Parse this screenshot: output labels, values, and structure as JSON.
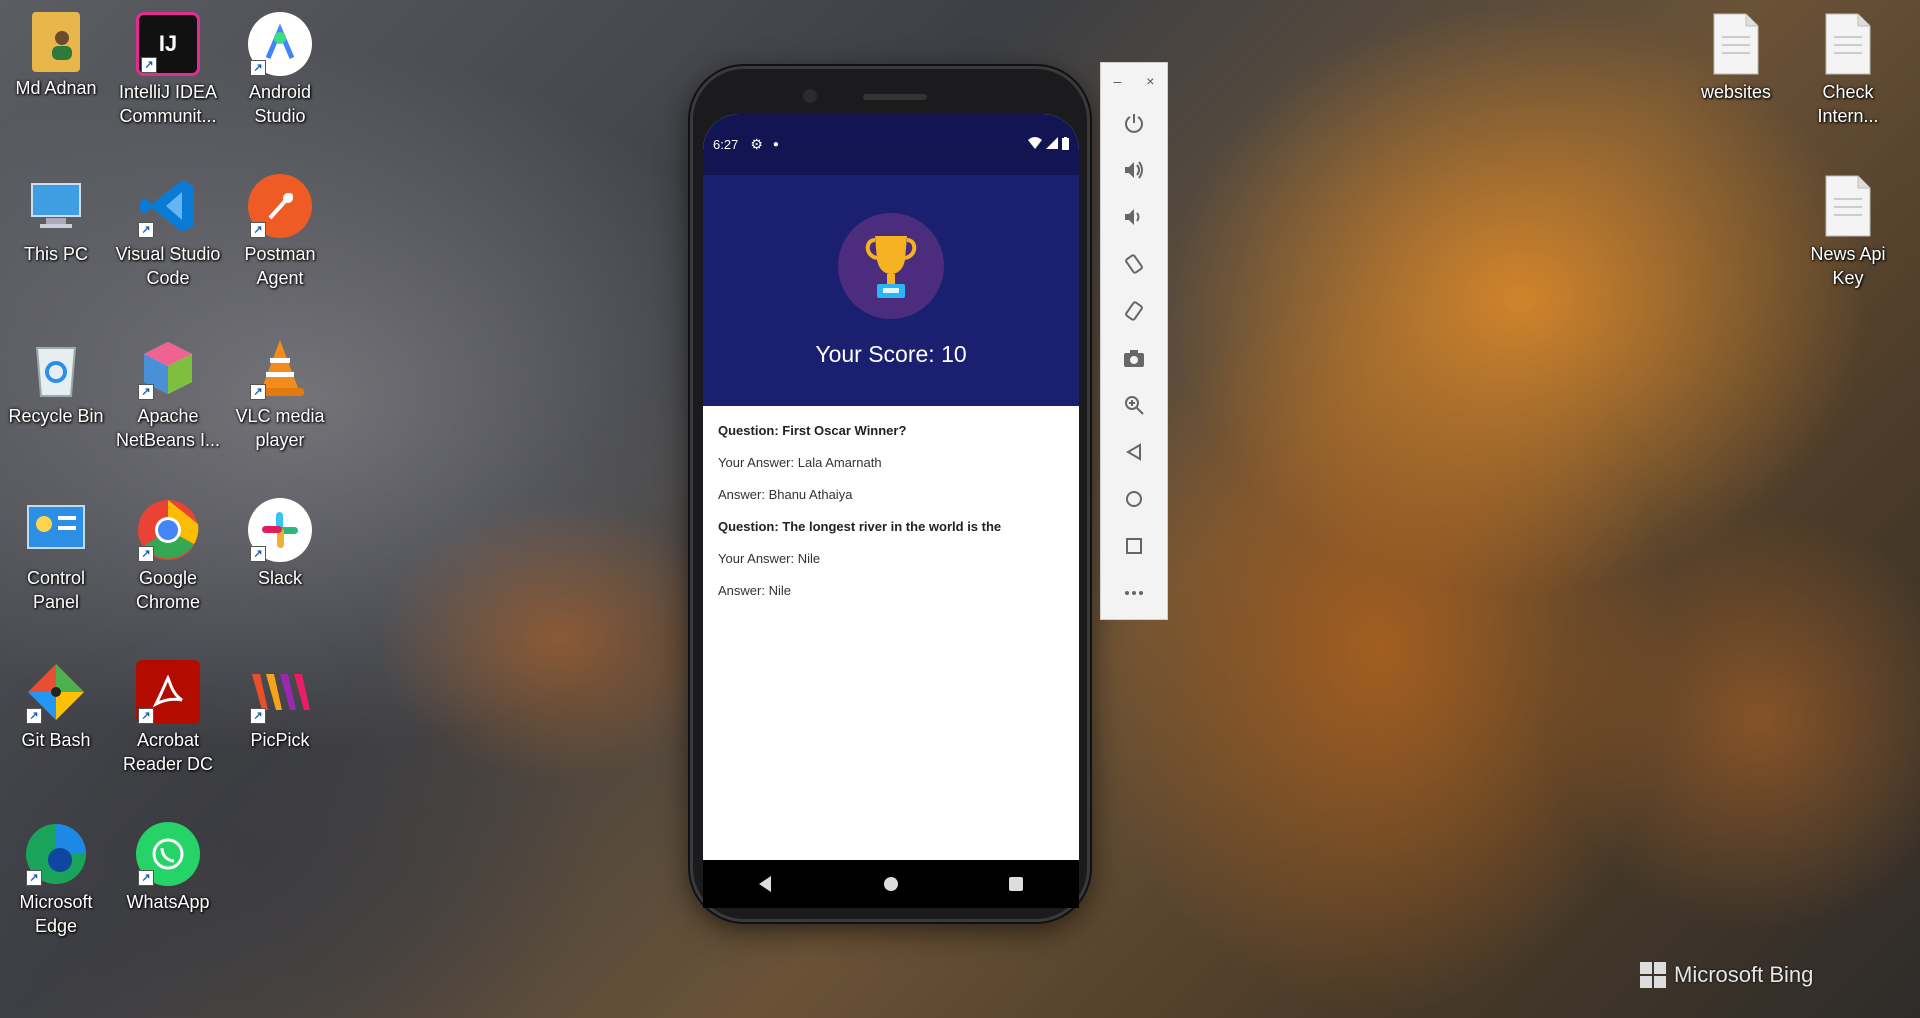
{
  "desktop_icons": [
    {
      "label": "Md Adnan",
      "icon": "user-folder-icon",
      "color": "#e8b64a"
    },
    {
      "label": "IntelliJ IDEA\nCommunit...",
      "icon": "intellij-icon",
      "color": "#111111"
    },
    {
      "label": "Android\nStudio",
      "icon": "android-studio-icon",
      "color": "#3ddc84"
    },
    {
      "label": "This PC",
      "icon": "this-pc-icon",
      "color": "#4aa3df"
    },
    {
      "label": "Visual Studio\nCode",
      "icon": "vscode-icon",
      "color": "#0078d4"
    },
    {
      "label": "Postman\nAgent",
      "icon": "postman-icon",
      "color": "#ef5b25"
    },
    {
      "label": "Recycle Bin",
      "icon": "recycle-bin-icon",
      "color": "#cfd8dc"
    },
    {
      "label": "Apache\nNetBeans I...",
      "icon": "netbeans-icon",
      "color": "#7fbf3f"
    },
    {
      "label": "VLC media\nplayer",
      "icon": "vlc-icon",
      "color": "#f28c1c"
    },
    {
      "label": "Control Panel",
      "icon": "control-panel-icon",
      "color": "#2d8ee6"
    },
    {
      "label": "Google\nChrome",
      "icon": "chrome-icon",
      "color": "#ea4335"
    },
    {
      "label": "Slack",
      "icon": "slack-icon",
      "color": "#ffffff"
    },
    {
      "label": "Git Bash",
      "icon": "git-bash-icon",
      "color": "#e84e31"
    },
    {
      "label": "Acrobat\nReader DC",
      "icon": "acrobat-icon",
      "color": "#b30b00"
    },
    {
      "label": "PicPick",
      "icon": "picpick-icon",
      "color": "#e9502a"
    },
    {
      "label": "Microsoft\nEdge",
      "icon": "edge-icon",
      "color": "#1aa35a"
    },
    {
      "label": "WhatsApp",
      "icon": "whatsapp-icon",
      "color": "#25d366"
    },
    {
      "label": "websites",
      "icon": "text-file-icon",
      "color": "#f4f4f4"
    },
    {
      "label": "Check\nIntern...",
      "icon": "text-file-icon",
      "color": "#f4f4f4"
    },
    {
      "label": "News Api Key",
      "icon": "text-file-icon",
      "color": "#f4f4f4"
    }
  ],
  "phone": {
    "status_time": "6:27",
    "score_text": "Your Score: 10",
    "results": [
      {
        "question": "Question: First Oscar Winner?",
        "your_answer": "Your Answer: Lala Amarnath",
        "answer": "Answer: Bhanu Athaiya"
      },
      {
        "question": "Question: The longest river in the world is the",
        "your_answer": "Your Answer: Nile",
        "answer": "Answer: Nile"
      }
    ],
    "colors": {
      "status_bar": "#131553",
      "header": "#1a1f70",
      "trophy_bg": "#4b2c7d"
    }
  },
  "emulator_panel": {
    "window_controls": [
      "–",
      "×"
    ],
    "tools": [
      "power-icon",
      "volume-up-icon",
      "volume-down-icon",
      "rotate-left-icon",
      "rotate-right-icon",
      "screenshot-icon",
      "zoom-icon",
      "back-icon",
      "home-icon",
      "overview-icon",
      "more-icon"
    ]
  },
  "watermark": "Microsoft Bing"
}
